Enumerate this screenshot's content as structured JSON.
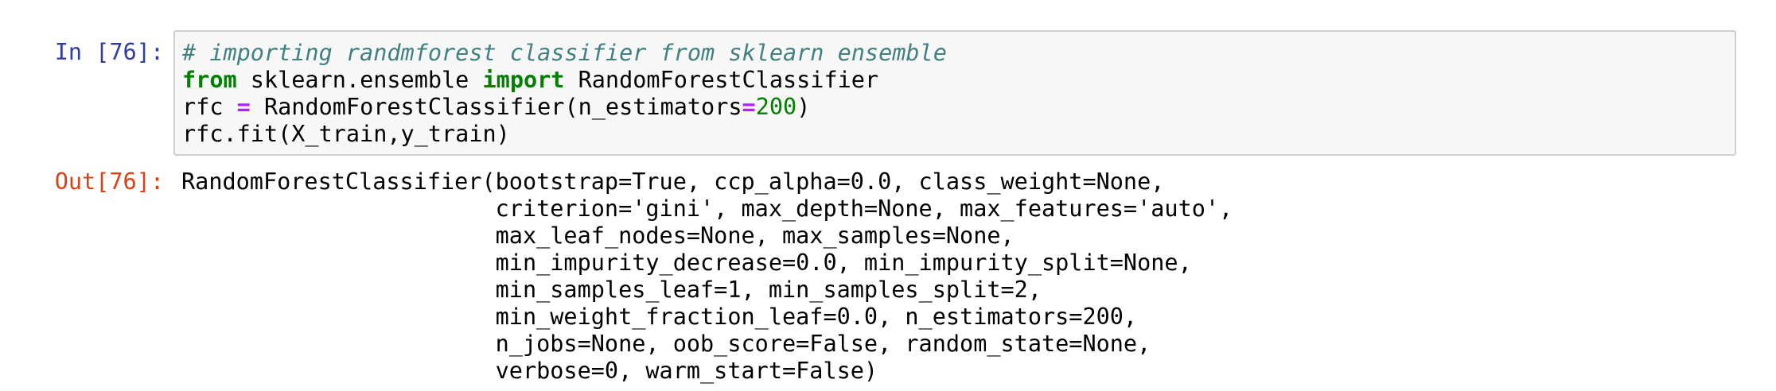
{
  "cell": {
    "input_prompt": "In [76]:",
    "output_prompt": "Out[76]:",
    "code": {
      "line1_comment": "# importing randmforest classifier from sklearn ensemble",
      "line2_kw_from": "from",
      "line2_module": " sklearn.ensemble ",
      "line2_kw_import": "import",
      "line2_name": " RandomForestClassifier",
      "line3_var": "rfc ",
      "line3_op_assign": "=",
      "line3_call": " RandomForestClassifier(n_estimators",
      "line3_op_eq": "=",
      "line3_num": "200",
      "line3_close": ")",
      "line4": "rfc.fit(X_train,y_train)"
    },
    "output_lines": [
      "RandomForestClassifier(bootstrap=True, ccp_alpha=0.0, class_weight=None,",
      "                       criterion='gini', max_depth=None, max_features='auto',",
      "                       max_leaf_nodes=None, max_samples=None,",
      "                       min_impurity_decrease=0.0, min_impurity_split=None,",
      "                       min_samples_leaf=1, min_samples_split=2,",
      "                       min_weight_fraction_leaf=0.0, n_estimators=200,",
      "                       n_jobs=None, oob_score=False, random_state=None,",
      "                       verbose=0, warm_start=False)"
    ]
  },
  "colors": {
    "input_prompt": "#303f9f",
    "output_prompt": "#d84315",
    "comment": "#408080",
    "keyword": "#008000",
    "operator": "#aa22ff",
    "number": "#008000",
    "input_background": "#f7f7f7",
    "input_border": "#cfcfcf"
  }
}
